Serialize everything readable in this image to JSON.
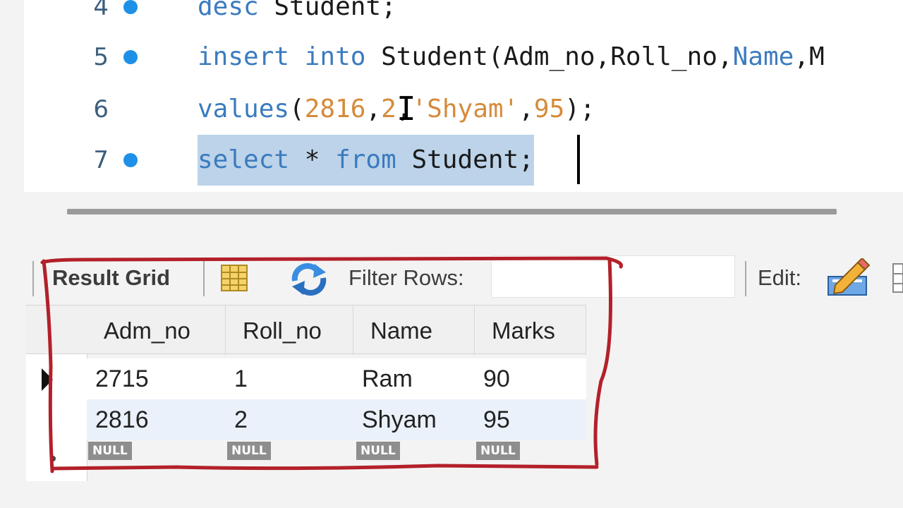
{
  "editor": {
    "lines": [
      {
        "number": "4",
        "has_marker": true
      },
      {
        "number": "5",
        "has_marker": true
      },
      {
        "number": "6",
        "has_marker": false
      },
      {
        "number": "7",
        "has_marker": true
      }
    ],
    "line4": {
      "kw": "desc",
      "rest": " Student;"
    },
    "line5": {
      "kw1": "insert",
      "kw2": "into",
      "name": "Student(Adm_no,Roll_no,",
      "kw3": "Name",
      "tail": ",M"
    },
    "line6": {
      "kw": "values",
      "open": "(",
      "n1": "2816",
      "c1": ",",
      "n2": "2",
      "c2": ",",
      "s": "'Shyam'",
      "c3": ",",
      "n3": "95",
      "close": ");"
    },
    "line7": {
      "kw1": "select",
      "star": " * ",
      "kw2": "from",
      "rest": " Student;"
    },
    "colors": {
      "keyword": "#3b7bbf",
      "literal": "#d58b3a",
      "selection": "#bcd3e9",
      "marker": "#1e90e8"
    }
  },
  "toolbar": {
    "result_grid_label": "Result Grid",
    "filter_label": "Filter Rows:",
    "filter_value": "",
    "edit_label": "Edit:"
  },
  "grid": {
    "columns": [
      "Adm_no",
      "Roll_no",
      "Name",
      "Marks"
    ],
    "rows": [
      [
        "2715",
        "1",
        "Ram",
        "90"
      ],
      [
        "2816",
        "2",
        "Shyam",
        "95"
      ]
    ],
    "null_label": "NULL",
    "selected_row_color": "#eaf1fa"
  },
  "annotation": {
    "color": "#b3202a"
  }
}
